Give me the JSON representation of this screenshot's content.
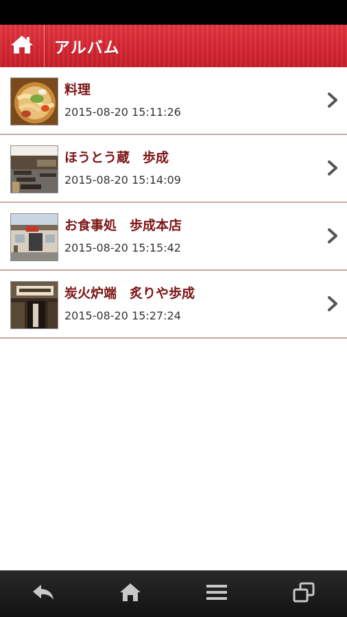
{
  "header": {
    "title": "アルバム",
    "home_icon": "home-icon",
    "accent_color": "#d52631"
  },
  "albums": [
    {
      "title": "料理",
      "date": "2015-08-20 15:11:26",
      "thumbnail": "food-photo"
    },
    {
      "title": "ほうとう蔵　歩成",
      "date": "2015-08-20 15:14:09",
      "thumbnail": "dining-room-photo"
    },
    {
      "title": "お食事処　歩成本店",
      "date": "2015-08-20 15:15:42",
      "thumbnail": "storefront-photo"
    },
    {
      "title": "炭火炉端　炙りや歩成",
      "date": "2015-08-20 15:27:24",
      "thumbnail": "entrance-photo"
    }
  ],
  "navbar": {
    "icons": [
      "back-icon",
      "home-icon",
      "menu-icon",
      "recent-apps-icon"
    ]
  },
  "colors": {
    "title_text": "#7b1414",
    "date_text": "#333333",
    "separator": "#c9a7a7"
  }
}
